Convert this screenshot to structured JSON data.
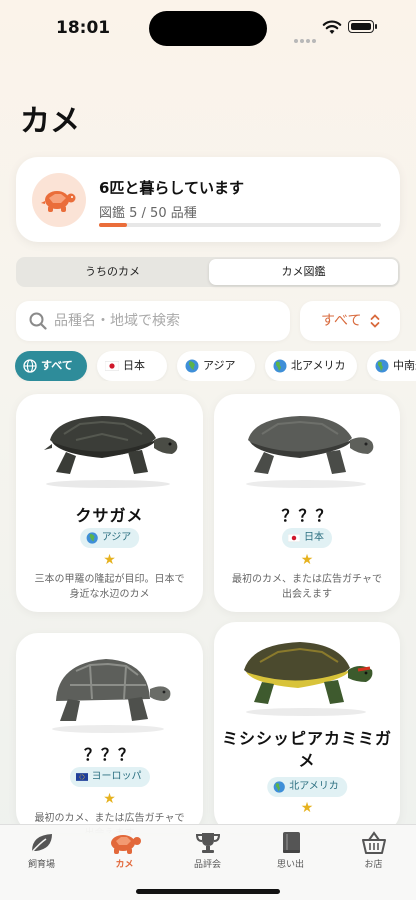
{
  "status": {
    "time": "18:01"
  },
  "title": "カメ",
  "summary": {
    "headline": "6匹と暮らしています",
    "progress_text": "図鑑 5 / 50 品種",
    "progress": 0.1,
    "accent": "#ea6d3a"
  },
  "tabs_segment": {
    "mine_label": "うちのカメ",
    "dex_label": "カメ図鑑",
    "selected": "カメ図鑑"
  },
  "search": {
    "placeholder": "品種名・地域で検索",
    "value": "",
    "filter_value": "すべて"
  },
  "region_chips": [
    {
      "label": "すべて",
      "icon": "globe-icon",
      "active": true
    },
    {
      "label": "日本",
      "icon": "japan-flag-icon"
    },
    {
      "label": "アジア",
      "icon": "earth-asia-icon"
    },
    {
      "label": "北アメリカ",
      "icon": "earth-americas-icon"
    },
    {
      "label": "中南米",
      "icon": "earth-americas-icon"
    }
  ],
  "cards": [
    {
      "name": "クサガメ",
      "region": "アジア",
      "region_icon": "earth-asia-icon",
      "stars": "★",
      "description": "三本の甲羅の隆起が目印。日本で身近な水辺のカメ"
    },
    {
      "name": "？？？",
      "region": "日本",
      "region_icon": "japan-flag-icon",
      "stars": "★",
      "description": "最初のカメ、または広告ガチャで出会えます"
    },
    {
      "name": "？？？",
      "region": "ヨーロッパ",
      "region_icon": "eu-flag-icon",
      "stars": "★",
      "description": "最初のカメ、または広告ガチャで出会えます"
    },
    {
      "name": "ミシシッピアカミミガメ",
      "region": "北アメリカ",
      "region_icon": "earth-americas-icon",
      "stars": "★",
      "description": ""
    }
  ],
  "tab_bar": [
    {
      "label": "飼育場",
      "icon": "leaf-icon"
    },
    {
      "label": "カメ",
      "icon": "turtle-icon",
      "active": true
    },
    {
      "label": "品評会",
      "icon": "trophy-icon"
    },
    {
      "label": "思い出",
      "icon": "book-icon"
    },
    {
      "label": "お店",
      "icon": "basket-icon"
    }
  ]
}
